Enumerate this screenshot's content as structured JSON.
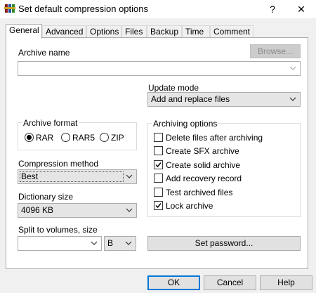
{
  "window": {
    "title": "Set default compression options",
    "help_label": "?",
    "close_label": "✕"
  },
  "tabs": [
    {
      "label": "General"
    },
    {
      "label": "Advanced"
    },
    {
      "label": "Options"
    },
    {
      "label": "Files"
    },
    {
      "label": "Backup"
    },
    {
      "label": "Time"
    },
    {
      "label": "Comment"
    }
  ],
  "archive": {
    "name_label": "Archive name",
    "name_value": "",
    "browse_label": "Browse..."
  },
  "update_mode": {
    "label": "Update mode",
    "value": "Add and replace files"
  },
  "archive_format": {
    "label": "Archive format",
    "options": [
      {
        "label": "RAR",
        "selected": true
      },
      {
        "label": "RAR5",
        "selected": false
      },
      {
        "label": "ZIP",
        "selected": false
      }
    ]
  },
  "archiving_options": {
    "label": "Archiving options",
    "items": [
      {
        "label": "Delete files after archiving",
        "checked": false
      },
      {
        "label": "Create SFX archive",
        "checked": false
      },
      {
        "label": "Create solid archive",
        "checked": true
      },
      {
        "label": "Add recovery record",
        "checked": false
      },
      {
        "label": "Test archived files",
        "checked": false
      },
      {
        "label": "Lock archive",
        "checked": true
      }
    ]
  },
  "compression_method": {
    "label": "Compression method",
    "value": "Best"
  },
  "dictionary_size": {
    "label": "Dictionary size",
    "value": "4096 KB"
  },
  "split": {
    "label": "Split to volumes, size",
    "value": "",
    "unit": "B"
  },
  "set_password_label": "Set password...",
  "buttons": {
    "ok": "OK",
    "cancel": "Cancel",
    "help": "Help"
  }
}
